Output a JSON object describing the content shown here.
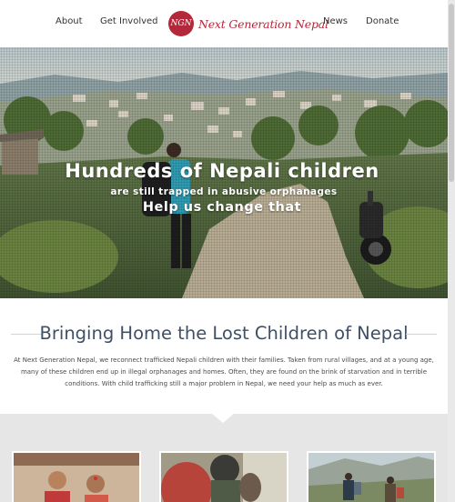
{
  "nav": {
    "about": "About",
    "get_involved": "Get Involved",
    "logo_text": "Next Generation Nepal",
    "logo_mark": "NGN",
    "news": "News",
    "donate": "Donate"
  },
  "hero": {
    "headline": "Hundreds of Nepali children",
    "subline": "are still trapped in abusive orphanages",
    "cta": "Help us change that"
  },
  "mission": {
    "title": "Bringing Home the Lost Children of Nepal",
    "body": "At Next Generation Nepal, we reconnect trafficked Nepali children with their families. Taken from rural villages, and at a young age, many of these children end up in illegal orphanages and homes. Often, they are found on the brink of starvation and in terrible conditions. With child trafficking still a major problem in Nepal, we need your help as much as ever."
  },
  "colors": {
    "brand": "#b3283a",
    "title": "#3e4f66"
  }
}
